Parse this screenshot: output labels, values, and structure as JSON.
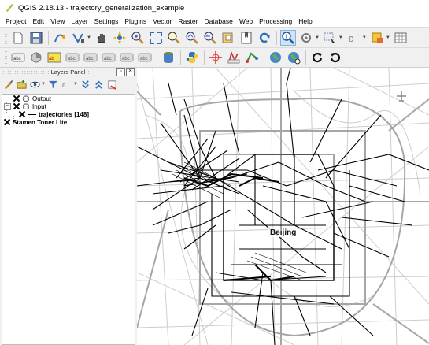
{
  "window": {
    "title": "QGIS 2.18.13 - trajectory_generalization_example"
  },
  "menu": [
    "Project",
    "Edit",
    "View",
    "Layer",
    "Settings",
    "Plugins",
    "Vector",
    "Raster",
    "Database",
    "Web",
    "Processing",
    "Help"
  ],
  "toolbar1": {
    "buttons": [
      "new-project-icon",
      "save-project-icon",
      "digitize-icon",
      "node-tool-icon",
      "pan-icon",
      "pan-to-selection-icon",
      "zoom-in-icon",
      "zoom-full-icon",
      "zoom-selection-icon",
      "zoom-layer-icon",
      "zoom-last-icon",
      "zoom-next-icon",
      "bookmark-icon",
      "refresh-icon",
      "identify-icon",
      "action-icon",
      "select-icon",
      "deselect-icon",
      "measure-icon",
      "attribute-table-icon"
    ]
  },
  "toolbar2": {
    "buttons": [
      "label-icon",
      "diagram-icon",
      "label-highlight-icon",
      "pin-label-icon",
      "show-label-icon",
      "move-label-icon",
      "rotate-label-icon",
      "change-label-icon",
      "db-manager-icon",
      "python-icon",
      "coordinate-capture-icon",
      "georeferencer-icon",
      "topology-checker-icon",
      "globe-icon",
      "globe-refresh-icon",
      "rotate-cw-icon",
      "rotate-ccw-icon"
    ]
  },
  "layers_panel": {
    "title": "Layers Panel",
    "tree": {
      "output": "Output",
      "input": "Input",
      "trajectories": "trajectories [148]",
      "basemap": "Stamen Toner Lite"
    }
  },
  "map": {
    "city_label": "Beijing",
    "colors": {
      "roads": "#cfcfcf",
      "major_roads": "#a9a9a9",
      "trajectories": "#000000"
    }
  }
}
